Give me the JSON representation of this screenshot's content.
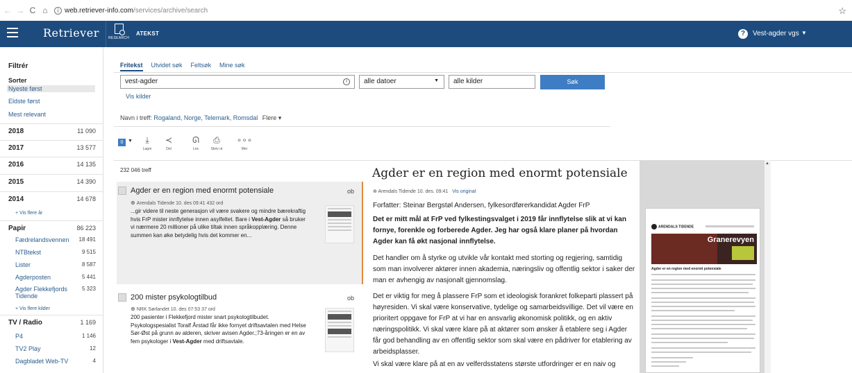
{
  "browser": {
    "url_host": "web.retriever-info.com",
    "url_path": "/services/archive/search"
  },
  "header": {
    "brand": "Retriever",
    "research_label": "RESEARCH",
    "product": "ATEKST",
    "user": "Vest-agder vgs"
  },
  "sidebar": {
    "title": "Filtrér",
    "sort_title": "Sorter",
    "sort_options": [
      "Nyeste først",
      "Eldste først",
      "Mest relevant"
    ],
    "years": [
      {
        "label": "2018",
        "count": "11 090"
      },
      {
        "label": "2017",
        "count": "13 577"
      },
      {
        "label": "2016",
        "count": "14 135"
      },
      {
        "label": "2015",
        "count": "14 390"
      },
      {
        "label": "2014",
        "count": "14 678"
      }
    ],
    "more_years": "+ Vis flere år",
    "paper": {
      "label": "Papir",
      "count": "86 223"
    },
    "paper_items": [
      {
        "label": "Fædrelandsvennen",
        "count": "18 491"
      },
      {
        "label": "NTBtekst",
        "count": "9 515"
      },
      {
        "label": "Lister",
        "count": "8 587"
      },
      {
        "label": "Agderposten",
        "count": "5 441"
      },
      {
        "label": "Agder Flekkefjords Tidende",
        "count": "5 323"
      }
    ],
    "more_sources": "+ Vis flere kilder",
    "tv": {
      "label": "TV / Radio",
      "count": "1 169"
    },
    "tv_items": [
      {
        "label": "P4",
        "count": "1 146"
      },
      {
        "label": "TV2 Play",
        "count": "12"
      },
      {
        "label": "Dagbladet Web-TV",
        "count": "4"
      }
    ]
  },
  "search": {
    "tabs": [
      "Fritekst",
      "Utvidet søk",
      "Feltsøk",
      "Mine søk"
    ],
    "query": "vest-agder",
    "date_range": "alle datoer",
    "sources": "alle kilder",
    "button": "Søk",
    "show_sources": "Vis kilder",
    "names_label": "Navn i treff:",
    "names": "Rogaland, Norge, Telemark, Romsdal",
    "more_names": "Flere ▾"
  },
  "toolbar": {
    "count": "0",
    "items": [
      "Lagre",
      "Del",
      "Les",
      "Skriv ut",
      "Mer"
    ]
  },
  "results": {
    "hits": "232 046 treff",
    "items": [
      {
        "title": "Agder er en region med enormt potensiale",
        "badge": "ob",
        "meta": "Arendals Tidende   10. des 09:41   432 ord",
        "snippet_1": "...gir videre til neste generasjon vil være svakere og mindre bærekraftig hvis FrP mister innflytelse innen asylfeltet. Bare i ",
        "snippet_bold": "Vest-Agder",
        "snippet_2": " så bruker vi nærmere 20 millioner på ulike tiltak innen språkopplæring. Denne summen kan øke betydelig hvis det kommer en..."
      },
      {
        "title": "200 mister psykologtilbud",
        "badge": "ob",
        "meta": "NRK Sørlandet   10. des 07:53   37 ord",
        "snippet_1": "200 pasienter i Flekkefjord mister snart psykologtilbudet. Psykologspesialist Toralf Årstad får ikke fornyet driftsavtalen med Helse Sør-Øst på grunn av alderen, skriver avisen Agder.;73-åringen er en av fem psykologer i ",
        "snippet_bold": "Vest-Agder",
        "snippet_2": " med driftsavtale."
      }
    ]
  },
  "article": {
    "title": "Agder er en region med enormt potensiale",
    "source": "Arendals Tidende   10. des. 09:41",
    "original_link": "Vis original",
    "author": "Forfatter: Steinar Bergstøl Andersen, fylkesordførerkandidat Agder FrP",
    "lead": "Det er mitt mål at FrP ved fylkestingsvalget i 2019 får innflytelse slik at vi kan fornye, forenkle og forberede Agder. Jeg har også klare planer på hvordan Agder kan få økt nasjonal innflytelse.",
    "p1": "Det handler om å styrke og utvikle vår kontakt med storting og regjering, samtidig som man involverer aktører innen akademia, næringsliv og offentlig sektor i saker der man er avhengig av nasjonalt gjennomslag.",
    "p2": "Det er viktig for meg å plassere FrP som et ideologisk forankret folkeparti plassert på høyresiden. Vi skal være konservative, tydelige og samarbeidsvillige. Det vil være en prioritert oppgave for FrP at vi har en ansvarlig økonomisk politikk, og en aktiv næringspolitikk. Vi skal være klare på at aktører som ønsker å etablere seg i Agder får god behandling av en offentlig sektor som skal være en pådriver for etablering av arbeidsplasser.",
    "p3": "Vi skal være klare på at en av velferdsstatens største utfordringer er en naiv og"
  },
  "preview": {
    "paper_name": "ARENDALS TIDENDE",
    "banner": "Granerevyen",
    "headline": "Agder er en region med enormt potensiale"
  }
}
